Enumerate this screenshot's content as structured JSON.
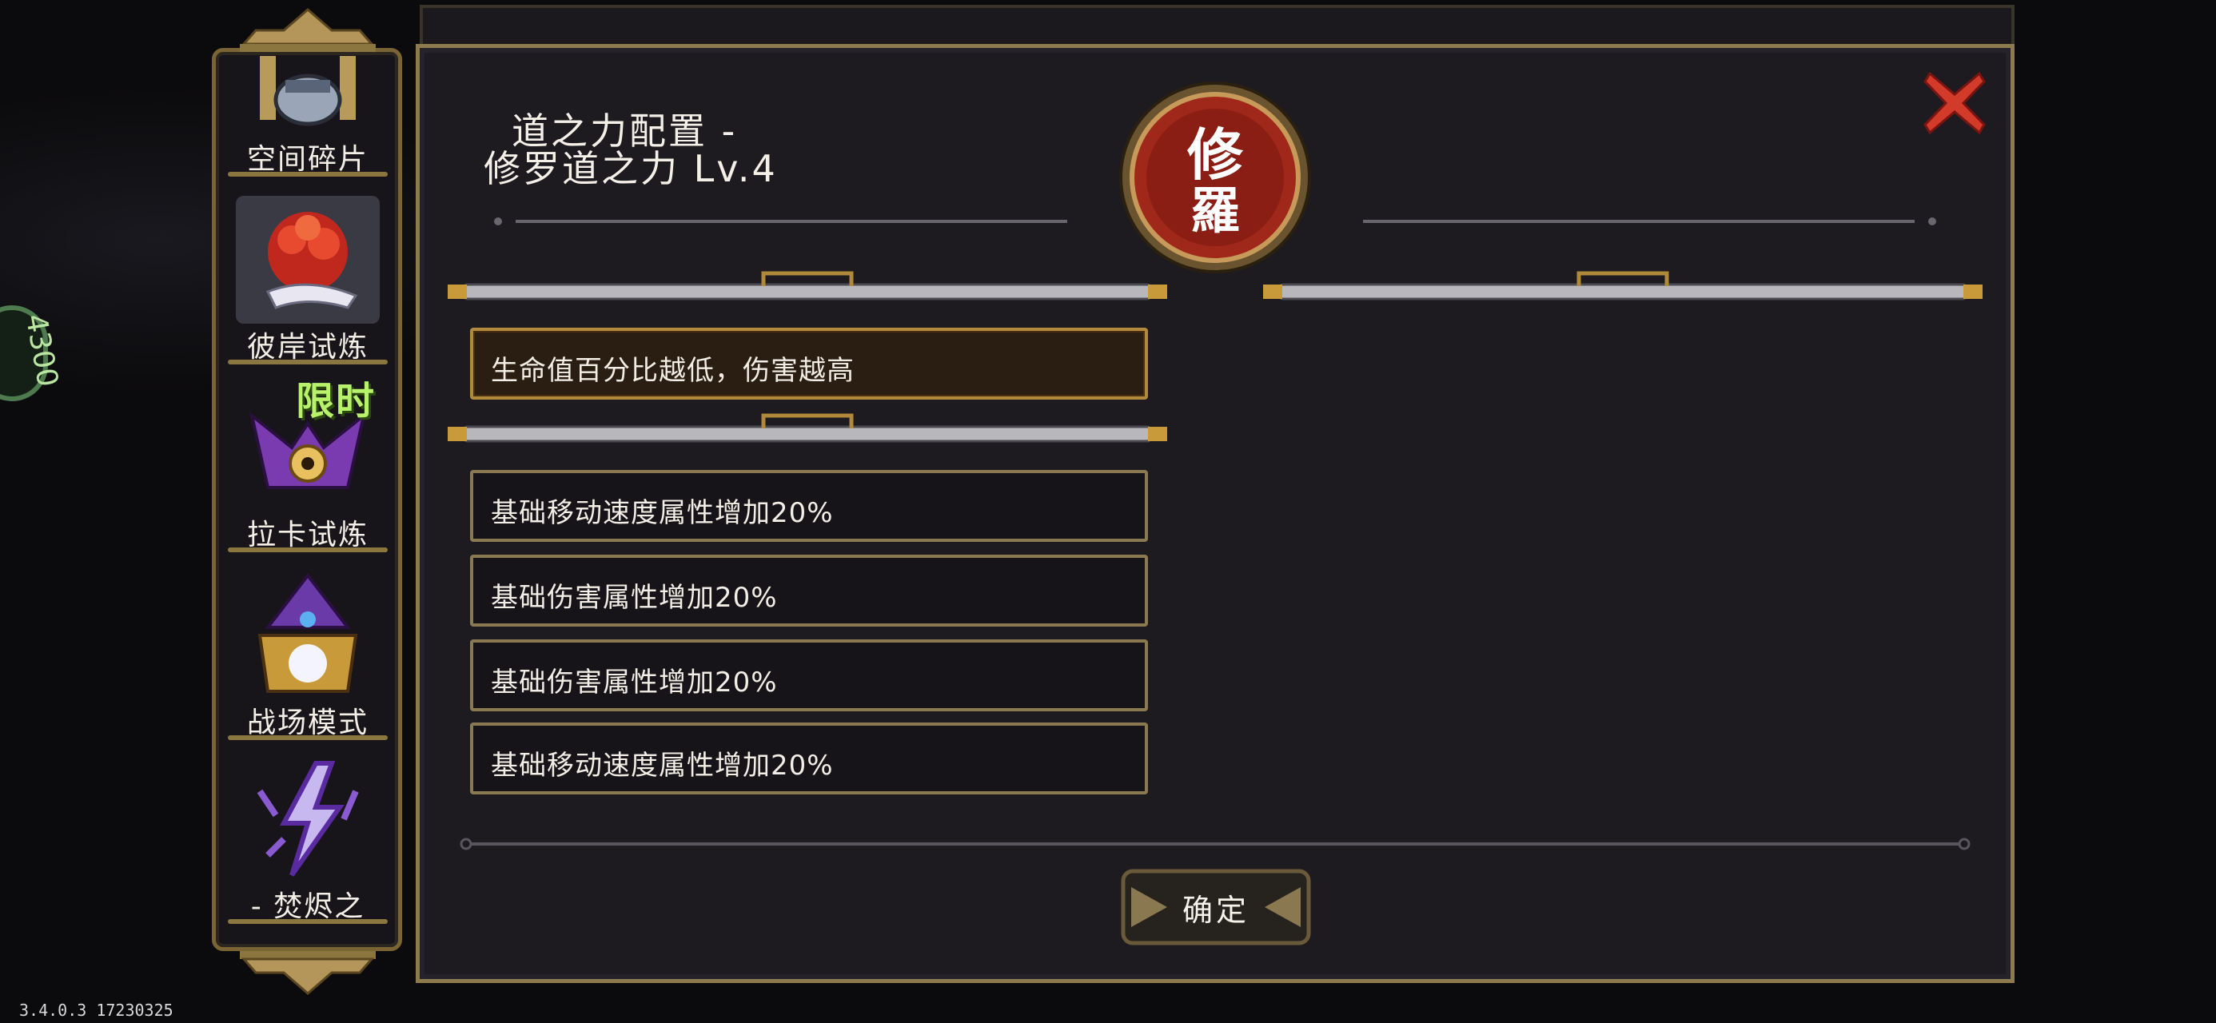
{
  "sidebar": {
    "items": [
      {
        "label": "空间碎片",
        "icon": "space-fragment-icon"
      },
      {
        "label": "彼岸试炼",
        "icon": "red-spider-lily-icon",
        "active": true
      },
      {
        "label": "拉卡试炼",
        "icon": "horned-crest-icon",
        "badge": "限时"
      },
      {
        "label": "战场模式",
        "icon": "purple-mage-icon"
      },
      {
        "label": "- 焚烬之",
        "icon": "purple-lightning-icon"
      }
    ]
  },
  "panel": {
    "title": "道之力配置 -",
    "subtitle": "修罗道之力 Lv.4",
    "emblem_text": "修羅",
    "main_effect": "生命值百分比越低，伤害越高",
    "sub_effects": [
      "基础移动速度属性增加20%",
      "基础伤害属性增加20%",
      "基础伤害属性增加20%",
      "基础移动速度属性增加20%"
    ],
    "confirm_label": "确定"
  },
  "edge_badge_text": "4300",
  "version": "3.4.0.3 17230325",
  "colors": {
    "gold_border": "#8d7a4f",
    "panel_bg": "#1d1b20",
    "close_red": "#d23a2a",
    "emblem_red": "#a0281a",
    "limited_green": "#b7f26a"
  }
}
